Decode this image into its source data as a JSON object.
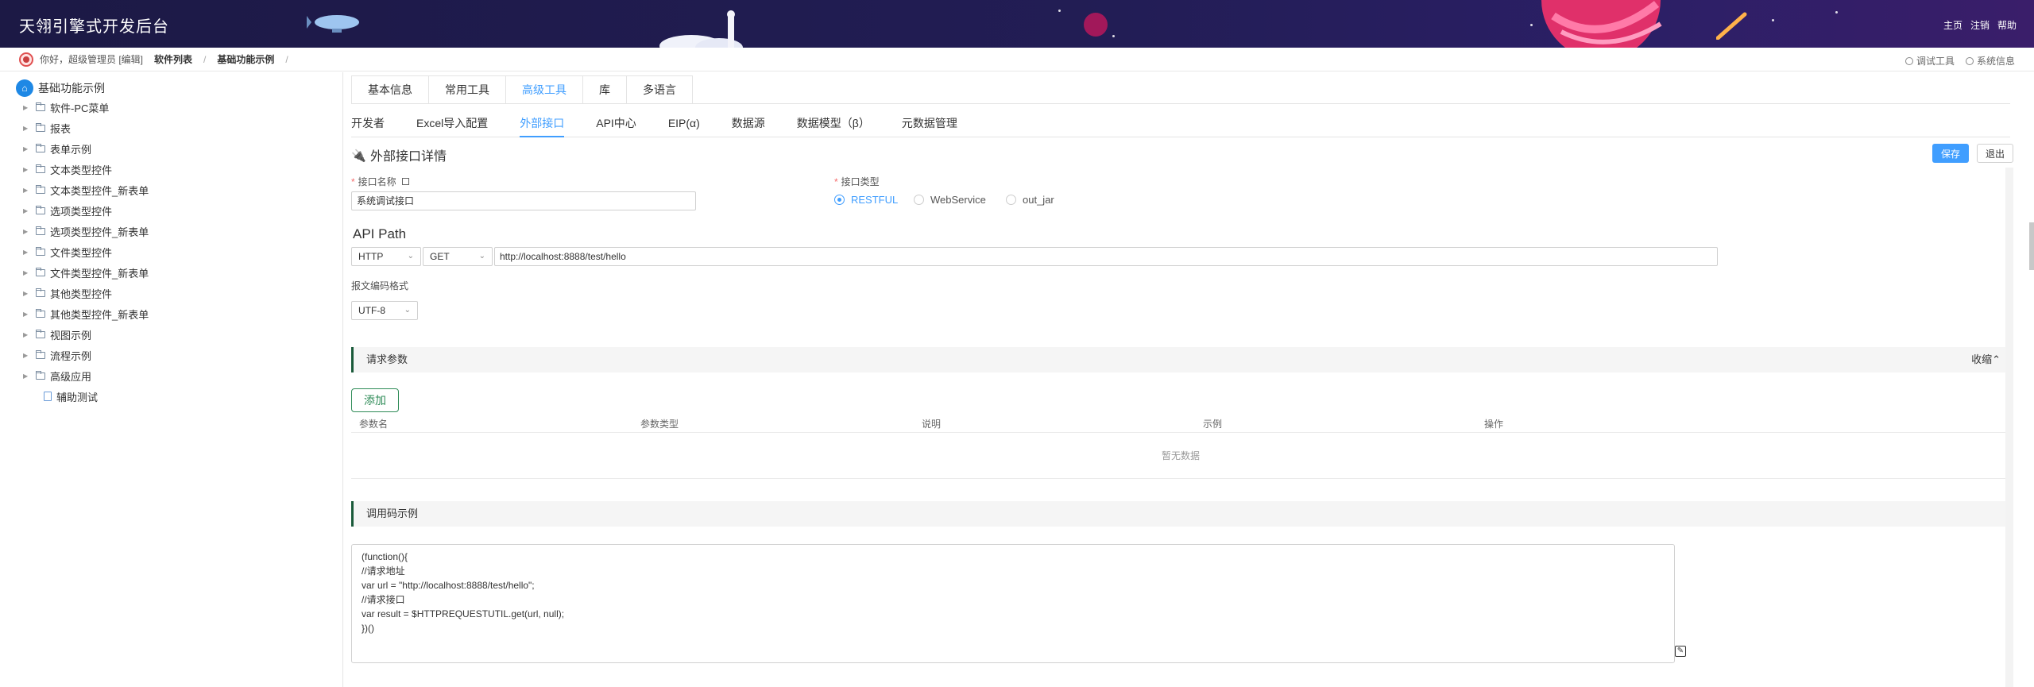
{
  "header": {
    "title": "天翎引擎式开发后台",
    "nav": [
      "主页",
      "注销",
      "帮助"
    ]
  },
  "crumbbar": {
    "greeting": "你好，超级管理员 [编辑]",
    "crumbs": [
      "软件列表",
      "/",
      "基础功能示例",
      "/"
    ],
    "tools": [
      "调试工具",
      "系统信息"
    ]
  },
  "sidebar": {
    "root": "基础功能示例",
    "items": [
      {
        "label": "软件-PC菜单"
      },
      {
        "label": "报表"
      },
      {
        "label": "表单示例"
      },
      {
        "label": "文本类型控件"
      },
      {
        "label": "文本类型控件_新表单"
      },
      {
        "label": "选项类型控件"
      },
      {
        "label": "选项类型控件_新表单"
      },
      {
        "label": "文件类型控件"
      },
      {
        "label": "文件类型控件_新表单"
      },
      {
        "label": "其他类型控件"
      },
      {
        "label": "其他类型控件_新表单"
      },
      {
        "label": "视图示例"
      },
      {
        "label": "流程示例"
      },
      {
        "label": "高级应用"
      }
    ],
    "leaf": "辅助测试"
  },
  "tabs": {
    "top": [
      "基本信息",
      "常用工具",
      "高级工具",
      "库",
      "多语言"
    ],
    "top_active": 2,
    "sub": [
      "开发者",
      "Excel导入配置",
      "外部接口",
      "API中心",
      "EIP(α)",
      "数据源",
      "数据模型（β）",
      "元数据管理"
    ],
    "sub_active": 2
  },
  "detail": {
    "title": "外部接口详情",
    "save": "保存",
    "exit": "退出",
    "name_label": "接口名称",
    "name_value": "系统调试接口",
    "type_label": "接口类型",
    "types": [
      "RESTFUL",
      "WebService",
      "out_jar"
    ],
    "type_selected": "RESTFUL",
    "api_path_title": "API Path",
    "protocol": "HTTP",
    "method": "GET",
    "url": "http://localhost:8888/test/hello",
    "encoding_label": "报文编码格式",
    "encoding": "UTF-8"
  },
  "params": {
    "title": "请求参数",
    "toggle": "收缩",
    "add": "添加",
    "columns": [
      "参数名",
      "参数类型",
      "说明",
      "示例",
      "操作"
    ],
    "empty": "暂无数据"
  },
  "code": {
    "title": "调用码示例",
    "content": "(function(){\n//请求地址\nvar url = \"http://localhost:8888/test/hello\";\n//请求接口\nvar result = $HTTPREQUESTUTIL.get(url, null);\n})()"
  },
  "colors": {
    "header_bg": "#1f1b4d",
    "accent": "#409eff",
    "add_green": "#2e8b57",
    "panel_bar": "#1a5a3a"
  }
}
